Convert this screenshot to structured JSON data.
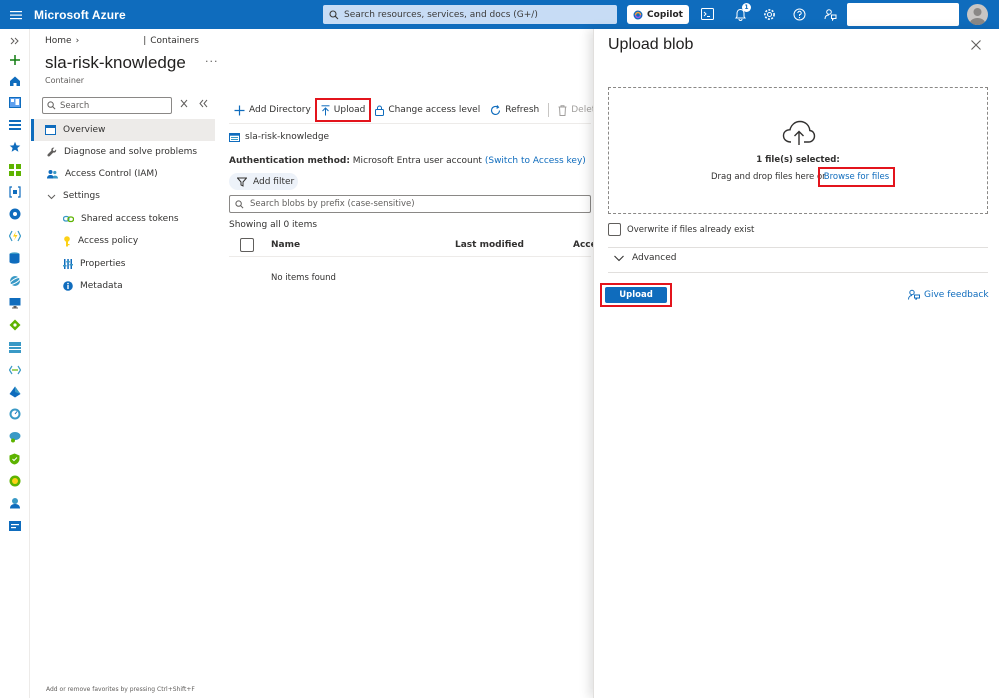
{
  "topbar": {
    "brand": "Microsoft Azure",
    "search_placeholder": "Search resources, services, and docs (G+/)",
    "copilot_label": "Copilot",
    "notification_count": "1"
  },
  "breadcrumb": {
    "home": "Home",
    "containers": "Containers"
  },
  "page": {
    "title": "sla-risk-knowledge",
    "subtitle": "Container"
  },
  "menu": {
    "search_placeholder": "Search",
    "items": [
      {
        "label": "Overview",
        "icon": "overview-icon"
      },
      {
        "label": "Diagnose and solve problems",
        "icon": "wrench-icon"
      },
      {
        "label": "Access Control (IAM)",
        "icon": "people-icon"
      },
      {
        "label": "Settings",
        "icon": "chevron-down-icon"
      },
      {
        "label": "Shared access tokens",
        "icon": "link-icon"
      },
      {
        "label": "Access policy",
        "icon": "key-icon"
      },
      {
        "label": "Properties",
        "icon": "properties-icon"
      },
      {
        "label": "Metadata",
        "icon": "info-icon"
      }
    ],
    "footer": "Add or remove favorites by pressing Ctrl+Shift+F"
  },
  "toolbar": {
    "add_directory": "Add Directory",
    "upload": "Upload",
    "change_access": "Change access level",
    "refresh": "Refresh",
    "delete": "Delete"
  },
  "content": {
    "path": "sla-risk-knowledge",
    "auth_label": "Authentication method:",
    "auth_value": "Microsoft Entra user account",
    "auth_link": "(Switch to Access key)",
    "add_filter": "Add filter",
    "blob_search_placeholder": "Search blobs by prefix (case-sensitive)",
    "showing": "Showing all 0 items",
    "columns": [
      "Name",
      "Last modified",
      "Acce"
    ],
    "empty": "No items found"
  },
  "panel": {
    "title": "Upload blob",
    "files_selected": "1 file(s) selected:",
    "drag_text": "Drag and drop files here or",
    "browse": "Browse for files",
    "overwrite": "Overwrite if files already exist",
    "advanced": "Advanced",
    "upload_button": "Upload",
    "feedback": "Give feedback"
  },
  "colors": {
    "brand_blue": "#0f6cbd",
    "highlight_red": "#e3141c"
  }
}
